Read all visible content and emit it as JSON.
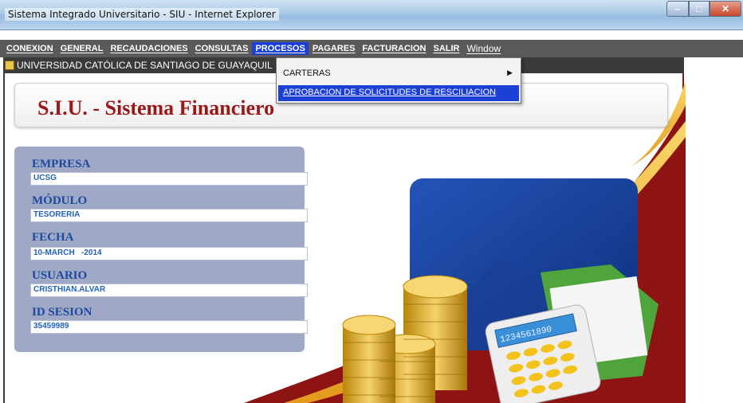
{
  "window": {
    "title": "Sistema Integrado Universitario - SIU - Internet Explorer",
    "minimize_label": "–",
    "maximize_label": "□",
    "close_label": "✕"
  },
  "menubar": {
    "items": [
      {
        "label": "CONEXION"
      },
      {
        "label": "GENERAL"
      },
      {
        "label": "RECAUDACIONES"
      },
      {
        "label": "CONSULTAS"
      },
      {
        "label": "PROCESOS",
        "active": true
      },
      {
        "label": "PAGARES"
      },
      {
        "label": "FACTURACION"
      },
      {
        "label": "SALIR"
      },
      {
        "label": "Window"
      }
    ]
  },
  "mdi": {
    "title": "UNIVERSIDAD CATÓLICA DE SANTIAGO DE GUAYAQUIL"
  },
  "header": {
    "title": "S.I.U. - Sistema Financiero"
  },
  "info": {
    "empresa_label": "EMPRESA",
    "empresa_value": "UCSG",
    "modulo_label": "MÓDULO",
    "modulo_value": "TESORERIA",
    "fecha_label": "FECHA",
    "fecha_value": "10-MARCH   -2014",
    "usuario_label": "USUARIO",
    "usuario_value": "CRISTHIAN.ALVAR",
    "sesion_label": "ID SESION",
    "sesion_value": "35459989"
  },
  "dropdown": {
    "carteras": "CARTERAS",
    "aprobacion": "APROBACION DE SOLICITUDES DE RESCILIACION"
  },
  "illustration": {
    "calculator_display": "1234561890"
  },
  "colors": {
    "menubar_bg": "#5a5a5a",
    "menu_highlight": "#1c3fd6",
    "brand_red": "#9c1818",
    "panel_blue": "#9fa8c4",
    "field_text": "#1f62b8"
  }
}
